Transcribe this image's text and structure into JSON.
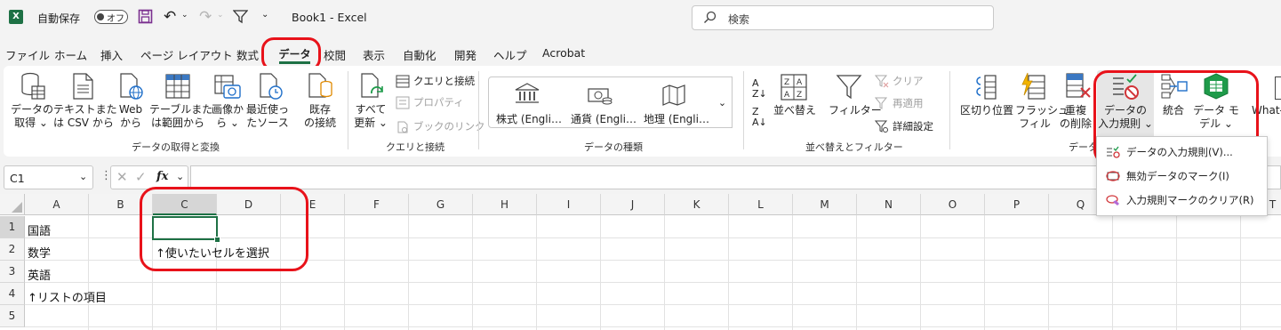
{
  "titlebar": {
    "autosave_label": "自動保存",
    "autosave_state": "オフ",
    "title": "Book1  -  Excel",
    "search_placeholder": "検索"
  },
  "tabs": [
    "ファイル",
    "ホーム",
    "挿入",
    "ページ レイアウト",
    "数式",
    "データ",
    "校閲",
    "表示",
    "自動化",
    "開発",
    "ヘルプ",
    "Acrobat"
  ],
  "ribbon": {
    "get_data": {
      "line1": "データの",
      "line2": "取得 ⌄"
    },
    "text_csv": {
      "line1": "テキストまた",
      "line2": "は CSV から"
    },
    "web": {
      "line1": "Web",
      "line2": "から"
    },
    "table_range": {
      "line1": "テーブルまた",
      "line2": "は範囲から"
    },
    "from_picture": {
      "line1": "画像か",
      "line2": "ら ⌄"
    },
    "recent_sources": {
      "line1": "最近使っ",
      "line2": "たソース"
    },
    "existing_conn": {
      "line1": "既存",
      "line2": "の接続"
    },
    "group_get_transform": "データの取得と変換",
    "refresh_all": {
      "line1": "すべて",
      "line2": "更新 ⌄"
    },
    "queries_conn": "クエリと接続",
    "properties": "プロパティ",
    "edit_links": "ブックのリンク",
    "group_queries": "クエリと接続",
    "stocks": "株式 (Engli…",
    "currencies": "通貨 (Engli…",
    "geography": "地理 (Engli…",
    "group_data_types": "データの種類",
    "sort_label": "並べ替え",
    "filter_label": "フィルター",
    "clear_label": "クリア",
    "reapply_label": "再適用",
    "advanced_label": "詳細設定",
    "group_sort_filter": "並べ替えとフィルター",
    "text_to_columns": "区切り位置",
    "flash_fill": {
      "line1": "フラッシュ",
      "line2": "フィル"
    },
    "remove_dup": {
      "line1": "重複",
      "line2": "の削除"
    },
    "data_validation": {
      "line1": "データの",
      "line2": "入力規則 ⌄"
    },
    "consolidate": "統合",
    "data_model": {
      "line1": "データ モ",
      "line2": "デル ⌄"
    },
    "whatif": "What-",
    "group_data_tools": "データ"
  },
  "dropdown": {
    "items": [
      "データの入力規則(V)...",
      "無効データのマーク(I)",
      "入力規則マークのクリア(R)"
    ]
  },
  "formula_bar": {
    "name_box": "C1",
    "fx": "fx"
  },
  "columns": [
    "A",
    "B",
    "C",
    "D",
    "E",
    "F",
    "G",
    "H",
    "I",
    "J",
    "K",
    "L",
    "M",
    "N",
    "O",
    "P",
    "Q",
    "R",
    "S",
    "T"
  ],
  "rows": [
    "1",
    "2",
    "3",
    "4",
    "5"
  ],
  "cells": {
    "A1": "国語",
    "A2": "数学",
    "A3": "英語",
    "A4": "↑リストの項目",
    "C2": "↑使いたいセルを選択"
  },
  "colors": {
    "excel_green": "#1e7145",
    "highlight_red": "#e8121a"
  }
}
